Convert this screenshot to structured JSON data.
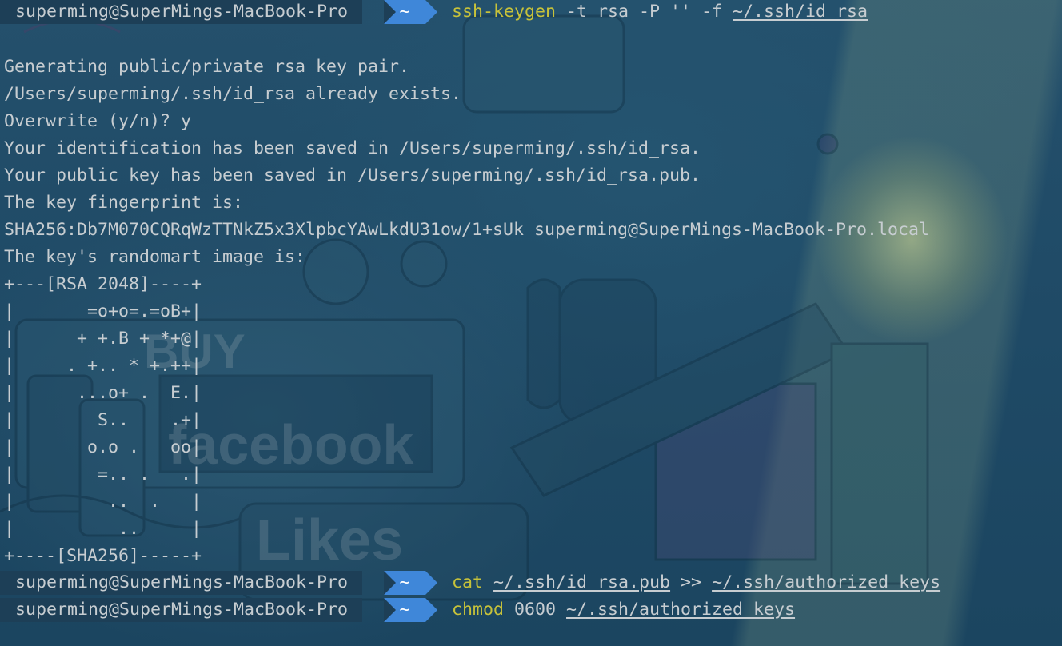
{
  "prompt": {
    "user_host": "superming@SuperMings-MacBook-Pro",
    "dir": "~"
  },
  "commands": [
    {
      "keyword": "ssh-keygen",
      "args_1": " -t rsa -P '' -f ",
      "path": "~/.ssh/id_rsa"
    },
    {
      "keyword": "cat",
      "args_1": " ",
      "path": "~/.ssh/id_rsa.pub",
      "args_2": " >> ",
      "path_2": "~/.ssh/authorized_keys"
    },
    {
      "keyword": "chmod",
      "args_1": " 0600 ",
      "path": "~/.ssh/authorized_keys"
    }
  ],
  "output": [
    "Generating public/private rsa key pair.",
    "/Users/superming/.ssh/id_rsa already exists.",
    "Overwrite (y/n)? y",
    "Your identification has been saved in /Users/superming/.ssh/id_rsa.",
    "Your public key has been saved in /Users/superming/.ssh/id_rsa.pub.",
    "The key fingerprint is:",
    "SHA256:Db7M070CQRqWzTTNkZ5x3XlpbcYAwLkdU31ow/1+sUk superming@SuperMings-MacBook-Pro.local",
    "The key's randomart image is:",
    "+---[RSA 2048]----+",
    "|       =o+o=.=oB+|",
    "|      + +.B + *+@|",
    "|     . +.. * +.++|",
    "|      ...o+ .  E.|",
    "|        S..    .+|",
    "|       o.o .   oo|",
    "|        =.. .   .|",
    "|         ..  .   |",
    "|          ..     |",
    "+----[SHA256]-----+"
  ],
  "colors": {
    "keyword": "#c7c23a",
    "text": "#c7cdd1",
    "dir_segment": "#3f87d9",
    "user_segment": "#1d3f57"
  }
}
